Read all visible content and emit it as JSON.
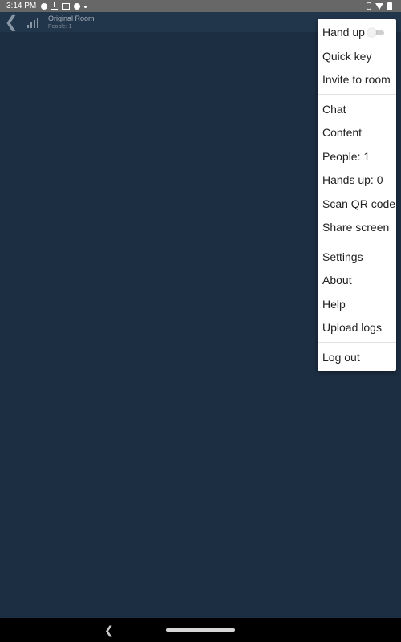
{
  "status": {
    "time": "3:14 PM",
    "icons": [
      "gear-icon",
      "download-icon",
      "mail-icon",
      "chat-icon",
      "dot-icon",
      "bluetooth-icon",
      "wifi-icon",
      "battery-icon"
    ]
  },
  "header": {
    "back_icon": "chevron-left-icon",
    "signal_icon": "signal-bars-icon",
    "room_title": "Original Room",
    "room_subtitle": "People: 1"
  },
  "menu": {
    "items": [
      "Hand up",
      "Quick key",
      "Invite to room",
      "Chat",
      "Content",
      "People: 1",
      "Hands up: 0",
      "Scan QR code",
      "Share screen",
      "Settings",
      "About",
      "Help",
      "Upload logs",
      "Log out"
    ],
    "hand_up_on": false
  },
  "nav": {
    "back_icon": "back-triangle-icon",
    "home_icon": "home-pill-icon"
  },
  "colors": {
    "background": "#1c2e42",
    "appbar": "#22364b",
    "statusbar": "#676767",
    "menu": "#ffffff",
    "navbar": "#000000"
  }
}
